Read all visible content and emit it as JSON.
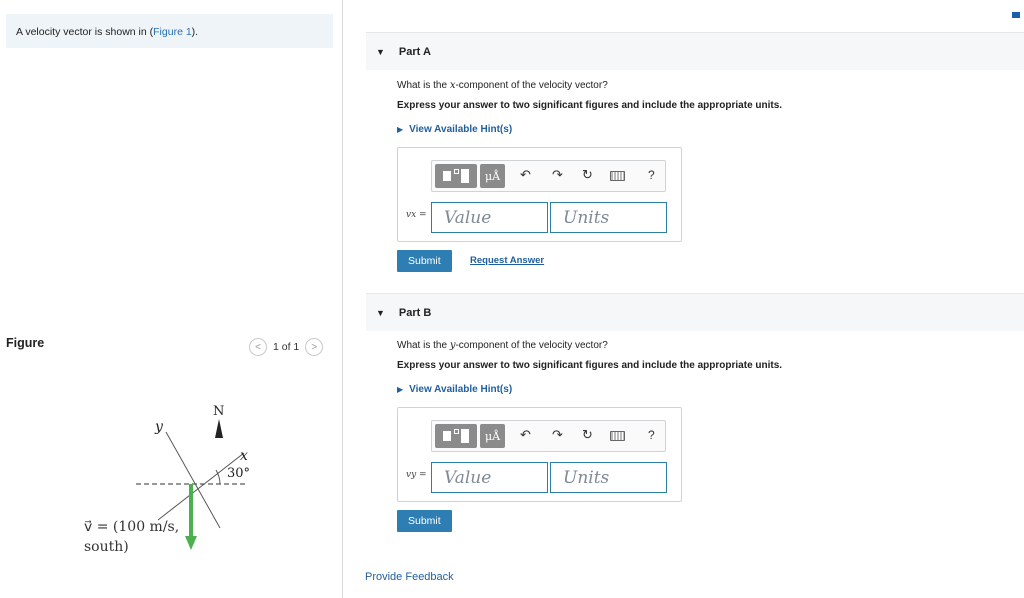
{
  "intro": {
    "text_before": "A velocity vector is shown in (",
    "link": "Figure 1",
    "text_after": ")."
  },
  "figure": {
    "heading": "Figure",
    "pager": "1 of 1",
    "labels": {
      "north": "N",
      "y_axis": "y",
      "x_axis": "x",
      "angle": "30°",
      "vector_line1": "v⃗ = (100 m/s,",
      "vector_line2": "south)"
    },
    "colors": {
      "vector": "#4caf50"
    }
  },
  "parts": [
    {
      "title": "Part A",
      "question_prefix": "What is the ",
      "question_var": "x",
      "question_suffix": "-component of the velocity vector?",
      "instruction": "Express your answer to two significant figures and include the appropriate units.",
      "hint": "View Available Hint(s)",
      "var_label": "vx =",
      "value_placeholder": "Value",
      "units_placeholder": "Units",
      "submit": "Submit",
      "request": "Request Answer"
    },
    {
      "title": "Part B",
      "question_prefix": "What is the ",
      "question_var": "y",
      "question_suffix": "-component of the velocity vector?",
      "instruction": "Express your answer to two significant figures and include the appropriate units.",
      "hint": "View Available Hint(s)",
      "var_label": "vy =",
      "value_placeholder": "Value",
      "units_placeholder": "Units",
      "submit": "Submit"
    }
  ],
  "toolbar": {
    "mu_label": "μÅ",
    "undo_icon": "↶",
    "redo_icon": "↷",
    "reset_icon": "↻",
    "help_icon": "?"
  },
  "feedback": "Provide Feedback",
  "colors": {
    "accent": "#2e7eb4",
    "link": "#1f5f9c"
  }
}
